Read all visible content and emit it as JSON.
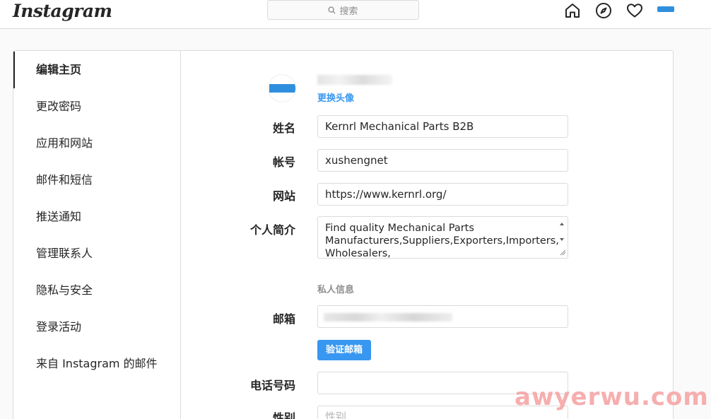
{
  "header": {
    "logo": "Instagram",
    "search_placeholder": "搜索"
  },
  "sidebar": {
    "items": [
      {
        "label": "编辑主页",
        "active": true
      },
      {
        "label": "更改密码"
      },
      {
        "label": "应用和网站"
      },
      {
        "label": "邮件和短信"
      },
      {
        "label": "推送通知"
      },
      {
        "label": "管理联系人"
      },
      {
        "label": "隐私与安全"
      },
      {
        "label": "登录活动"
      },
      {
        "label": "来自 Instagram 的邮件"
      }
    ]
  },
  "profile": {
    "change_photo_label": "更换头像"
  },
  "form": {
    "name_label": "姓名",
    "name_value": "Kernrl Mechanical Parts B2B",
    "username_label": "帐号",
    "username_value": "xushengnet",
    "website_label": "网站",
    "website_value": "https://www.kernrl.org/",
    "bio_label": "个人简介",
    "bio_value": "Find quality Mechanical Parts Manufacturers,Suppliers,Exporters,Importers, Wholesalers,",
    "private_info_label": "私人信息",
    "email_label": "邮箱",
    "verify_email_label": "验证邮箱",
    "phone_label": "电话号码",
    "phone_value": "",
    "gender_label": "性别",
    "gender_placeholder": "性别"
  },
  "watermark": "awyerwu.com",
  "colors": {
    "accent": "#3897f0",
    "border": "#dbdbdb",
    "avatar_blue": "#2f8fde"
  }
}
